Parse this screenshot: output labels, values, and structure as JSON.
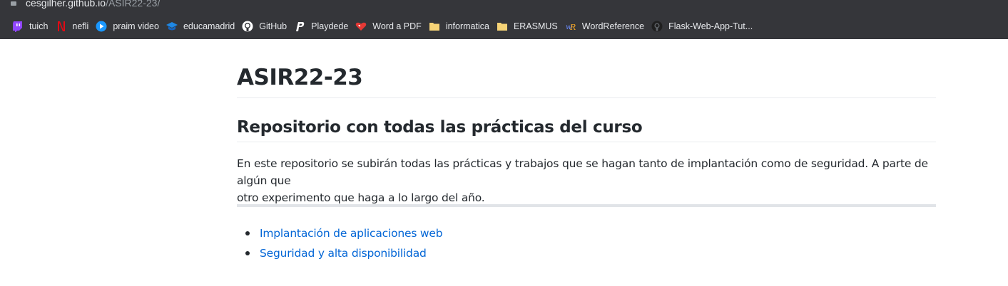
{
  "browser": {
    "url_host": "cesgilher.github.io",
    "url_path": "/ASIR22-23/",
    "bookmarks": [
      {
        "label": "tuich",
        "icon": "twitch-icon",
        "color": "#9146ff"
      },
      {
        "label": "nefli",
        "icon": "netflix-icon",
        "color": "#e50914"
      },
      {
        "label": "praim video",
        "icon": "prime-video-icon",
        "color": "#1a98ff"
      },
      {
        "label": "educamadrid",
        "icon": "graduation-cap-icon",
        "color": "#1e88e5"
      },
      {
        "label": "GitHub",
        "icon": "github-icon",
        "color": "#ffffff"
      },
      {
        "label": "Playdede",
        "icon": "playdede-icon",
        "color": "#ffffff"
      },
      {
        "label": "Word a PDF",
        "icon": "heart-icon",
        "color": "#e53935"
      },
      {
        "label": "informatica",
        "icon": "folder-icon",
        "color": "#f6d376"
      },
      {
        "label": "ERASMUS",
        "icon": "folder-icon",
        "color": "#f6d376"
      },
      {
        "label": "WordReference",
        "icon": "wordreference-icon",
        "color": "#f5a623"
      },
      {
        "label": "Flask-Web-App-Tut...",
        "icon": "github-icon",
        "color": "#ffffff"
      }
    ]
  },
  "page": {
    "title": "ASIR22-23",
    "subtitle": "Repositorio con todas las prácticas del curso",
    "intro_line1": "En este repositorio se subirán todas las prácticas y trabajos que se hagan tanto de implantación como de seguridad. A parte de algún que",
    "intro_line2": "otro experimento que haga a lo largo del año.",
    "links": [
      {
        "label": "Implantación de aplicaciones web"
      },
      {
        "label": "Seguridad y alta disponibilidad"
      }
    ],
    "link_color": "#0366d6"
  }
}
